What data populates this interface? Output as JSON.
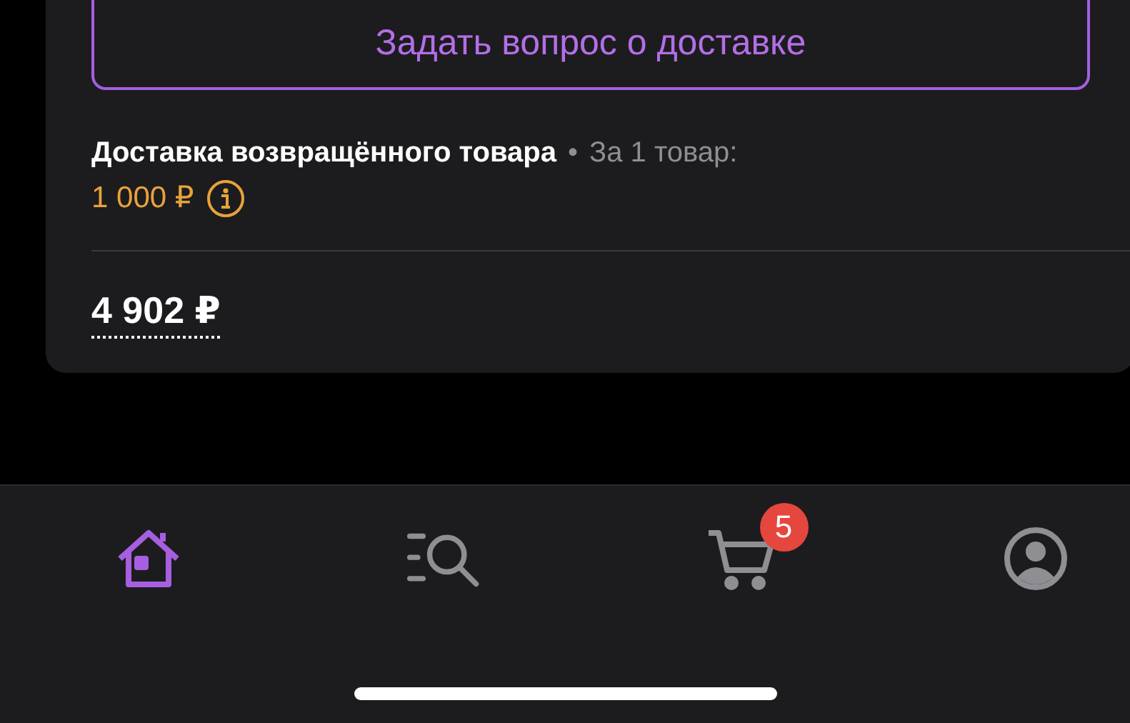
{
  "card": {
    "ask_button": "Задать вопрос о доставке",
    "delivery": {
      "title": "Доставка возвращённого товара",
      "separator": "•",
      "note": "За 1 товар:",
      "price": "1 000 ₽"
    },
    "total": "4 902 ₽"
  },
  "tab_bar": {
    "items": [
      {
        "kind": "home",
        "selected": true
      },
      {
        "kind": "catalog",
        "selected": false
      },
      {
        "kind": "cart",
        "selected": false,
        "badge": "5"
      },
      {
        "kind": "profile",
        "selected": false
      }
    ]
  }
}
